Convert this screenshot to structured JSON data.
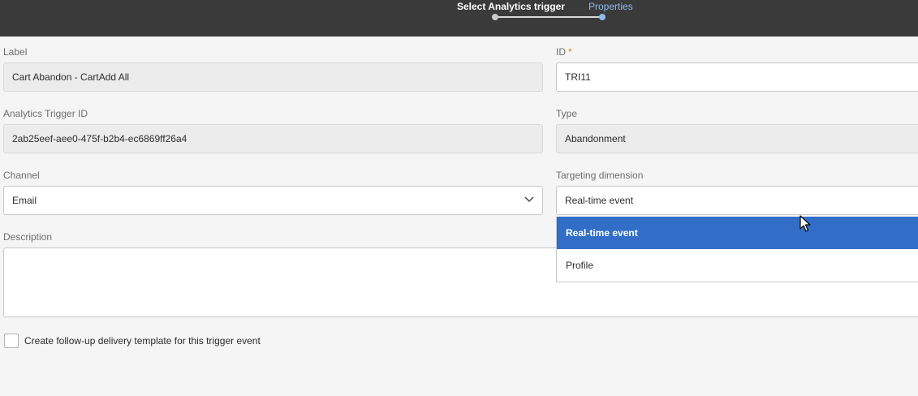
{
  "wizard": {
    "step1_label": "Select Analytics trigger",
    "step2_label": "Properties",
    "active_step": 2
  },
  "form": {
    "label_label": "Label",
    "label_value": "Cart Abandon - CartAdd All",
    "id_label": "ID",
    "id_required_mark": "*",
    "id_value": "TRI11",
    "analytics_trigger_id_label": "Analytics Trigger ID",
    "analytics_trigger_id_value": "2ab25eef-aee0-475f-b2b4-ec6869ff26a4",
    "type_label": "Type",
    "type_value": "Abandonment",
    "channel_label": "Channel",
    "channel_value": "Email",
    "targeting_dimension_label": "Targeting dimension",
    "targeting_dimension_value": "Real-time event",
    "targeting_dimension_options": [
      "Real-time event",
      "Profile"
    ],
    "description_label": "Description",
    "description_value": "",
    "followup_checkbox_label": "Create follow-up delivery template for this trigger event",
    "followup_checked": false
  },
  "colors": {
    "topbar": "#3a3a3a",
    "active_step": "#8fbaf1",
    "selected_option": "#326ec8",
    "required_mark": "#e68619"
  },
  "icons": {
    "channel_dropdown": "chevron-down-icon",
    "pointer": "mouse-cursor-icon"
  }
}
